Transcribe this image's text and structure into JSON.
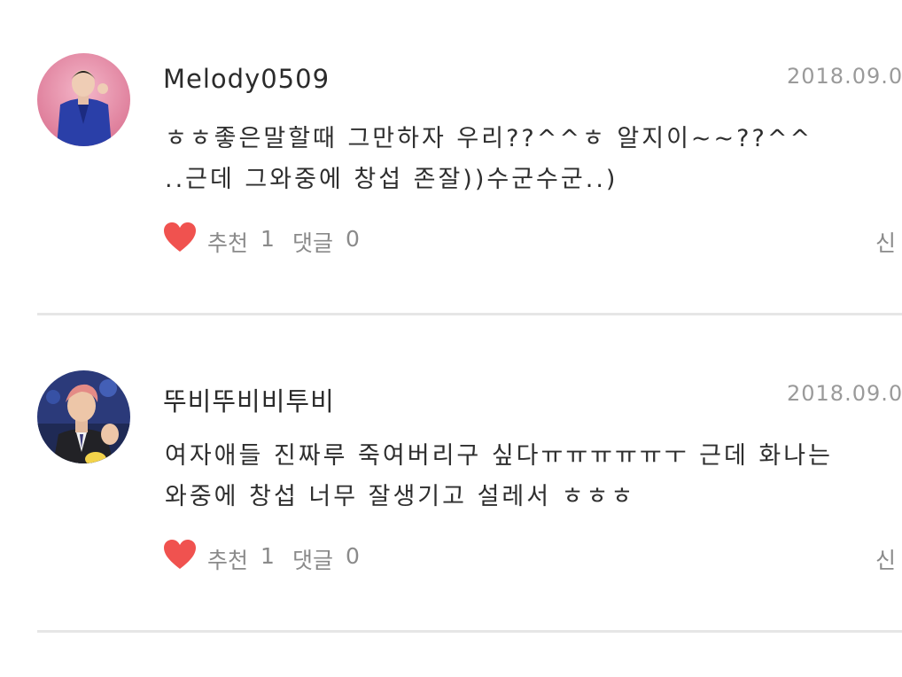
{
  "comments": [
    {
      "username": "Melody0509",
      "date": "2018.09.0",
      "body_line1": "ㅎㅎ좋은말할때 그만하자 우리??^^ㅎ 알지이~~??^^",
      "body_line2": "..근데 그와중에 창섭 존잘))수군수군..)",
      "recommend_label": "추천",
      "recommend_count": "1",
      "reply_label": "댓글",
      "reply_count": "0",
      "report_label": "신"
    },
    {
      "username": "뚜비뚜비비투비",
      "date": "2018.09.0",
      "body_line1": "여자애들 진짜루 죽여버리구 싶다ㅠㅠㅠㅠㅠㅜ 근데 화나는",
      "body_line2": "와중에 창섭 너무 잘생기고 설레서 ㅎㅎㅎ",
      "recommend_label": "추천",
      "recommend_count": "1",
      "reply_label": "댓글",
      "reply_count": "0",
      "report_label": "신"
    }
  ],
  "colors": {
    "heart": "#f0524f",
    "date": "#9a9a9a",
    "muted_text": "#8a8a8a",
    "divider": "#e6e6e6"
  },
  "icons": {
    "like": "heart-icon"
  }
}
